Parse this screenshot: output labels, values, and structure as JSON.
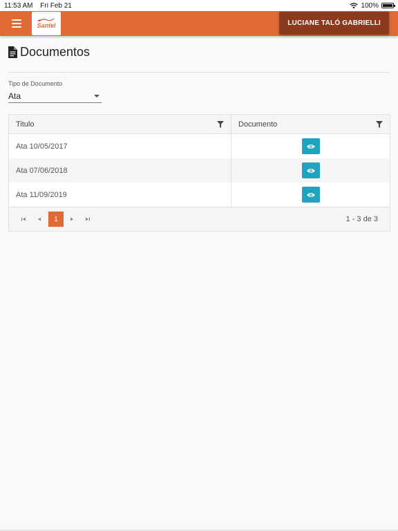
{
  "status_bar": {
    "time": "11:53 AM",
    "date": "Fri Feb 21",
    "battery": "100%",
    "battery_level": 1.0
  },
  "header": {
    "menu_icon": "hamburger-menu-icon",
    "logo_text": "Santel",
    "user_name": "LUCIANE TALÓ GABRIELLI",
    "accent_color": "#e06a35",
    "user_button_color": "#8b3a1e"
  },
  "page": {
    "title": "Documentos",
    "title_icon": "document-icon"
  },
  "document_type": {
    "label": "Tipo de Documento",
    "value": "Ata"
  },
  "grid": {
    "columns": [
      {
        "label": "Titulo",
        "filter_icon": "filter-icon"
      },
      {
        "label": "Documento",
        "filter_icon": "filter-icon"
      }
    ],
    "rows": [
      {
        "title": "Ata 10/05/2017",
        "action_icon": "eye-icon"
      },
      {
        "title": "Ata 07/06/2018",
        "action_icon": "eye-icon"
      },
      {
        "title": "Ata 11/09/2019",
        "action_icon": "eye-icon"
      }
    ],
    "view_button_color": "#1fa3bf"
  },
  "pager": {
    "current_page": "1",
    "info": "1 - 3 de 3"
  }
}
